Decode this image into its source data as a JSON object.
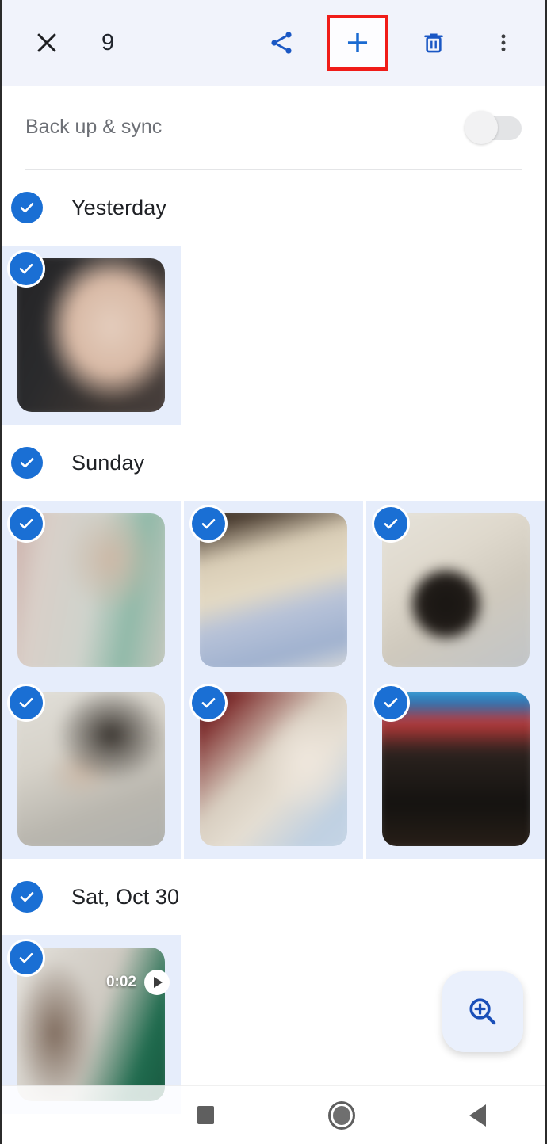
{
  "appbar": {
    "close_icon": "close-icon",
    "selection_count": "9",
    "share_icon": "share-icon",
    "add_icon": "plus-icon",
    "delete_icon": "trash-icon",
    "overflow_icon": "more-vertical-icon",
    "highlight_color": "#f01c18",
    "accent_color": "#1a6fd4",
    "background_color": "#f1f3fb"
  },
  "backup": {
    "label": "Back up & sync",
    "toggle_state": "off"
  },
  "sections": [
    {
      "title": "Yesterday",
      "selected": true,
      "rows": [
        [
          {
            "name": "photo-baby-dark",
            "style": "ph-baby-dark",
            "selected": true,
            "type": "photo"
          }
        ]
      ]
    },
    {
      "title": "Sunday",
      "selected": true,
      "rows": [
        [
          {
            "name": "photo-mirror",
            "style": "ph-mirror",
            "selected": true,
            "type": "photo"
          },
          {
            "name": "photo-towel",
            "style": "ph-towel",
            "selected": true,
            "type": "photo"
          },
          {
            "name": "photo-head",
            "style": "ph-head",
            "selected": true,
            "type": "photo"
          }
        ],
        [
          {
            "name": "photo-sleep",
            "style": "ph-sleep",
            "selected": true,
            "type": "photo"
          },
          {
            "name": "photo-play",
            "style": "ph-play",
            "selected": true,
            "type": "photo"
          },
          {
            "name": "photo-tv",
            "style": "ph-tv",
            "selected": true,
            "type": "photo"
          }
        ]
      ]
    },
    {
      "title": "Sat, Oct 30",
      "selected": true,
      "rows": [
        [
          {
            "name": "video-clip",
            "style": "ph-video",
            "selected": true,
            "type": "video",
            "duration": "0:02"
          }
        ]
      ]
    }
  ],
  "fab": {
    "icon": "zoom-in-icon",
    "background_color": "#eaf0fc"
  },
  "navbar": {
    "recents_label": "recents-square",
    "home_label": "home-circle",
    "back_label": "back-triangle"
  }
}
